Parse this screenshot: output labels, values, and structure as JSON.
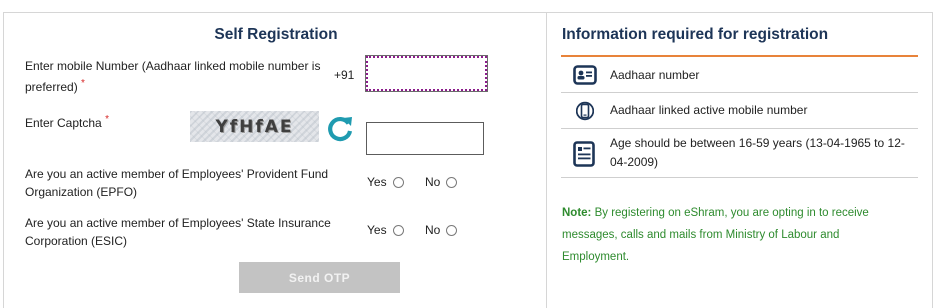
{
  "self_registration": {
    "title": "Self Registration",
    "mobile_label": "Enter mobile Number (Aadhaar linked mobile number is preferred)",
    "required_mark": "*",
    "country_code": "+91",
    "mobile_value": "",
    "captcha_label": "Enter Captcha",
    "captcha_text": "YfHfAE",
    "captcha_value": "",
    "epfo_question": "Are you an active member of Employees' Provident Fund Organization (EPFO)",
    "esic_question": "Are you an active member of Employees' State Insurance Corporation (ESIC)",
    "yes_label": "Yes",
    "no_label": "No",
    "send_otp_label": "Send OTP"
  },
  "info": {
    "title": "Information required for registration",
    "items": [
      {
        "icon": "id-card-icon",
        "text": "Aadhaar number"
      },
      {
        "icon": "mobile-phone-icon",
        "text": "Aadhaar linked active mobile number"
      },
      {
        "icon": "document-icon",
        "text": "Age should be between 16-59 years (13-04-1965 to 12-04-2009)"
      }
    ],
    "note_prefix": "Note:",
    "note_text": " By registering on eShram, you are opting in to receive messages, calls and mails from Ministry of Labour and Employment."
  },
  "colors": {
    "heading": "#1d3557",
    "accent_orange": "#e8833a",
    "note_green": "#2e8b2e",
    "refresh_teal": "#1f9bb0",
    "required_red": "#d62828"
  }
}
